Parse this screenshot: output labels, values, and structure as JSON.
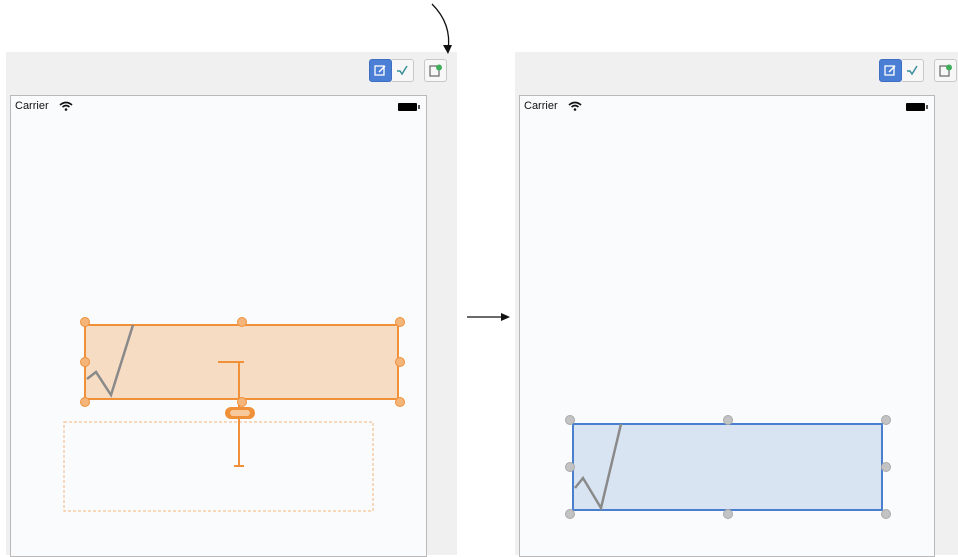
{
  "before": {
    "status_bar": {
      "carrier": "Carrier"
    },
    "toolbar": {
      "icons": [
        "editor-icon",
        "assistant-icon",
        "storyboard-icon"
      ]
    },
    "selected_view": {
      "state": "misplaced",
      "accent": "#f0913a",
      "fill": "#f7dcc4",
      "ghost_frame_accent": "#f4b47a"
    }
  },
  "after": {
    "status_bar": {
      "carrier": "Carrier"
    },
    "toolbar": {
      "icons": [
        "editor-icon",
        "assistant-icon",
        "storyboard-icon"
      ]
    },
    "selected_view": {
      "state": "updated",
      "accent": "#4a7fd0",
      "fill": "#d9e4f3"
    }
  },
  "transition": {
    "arrow": "right-arrow"
  }
}
